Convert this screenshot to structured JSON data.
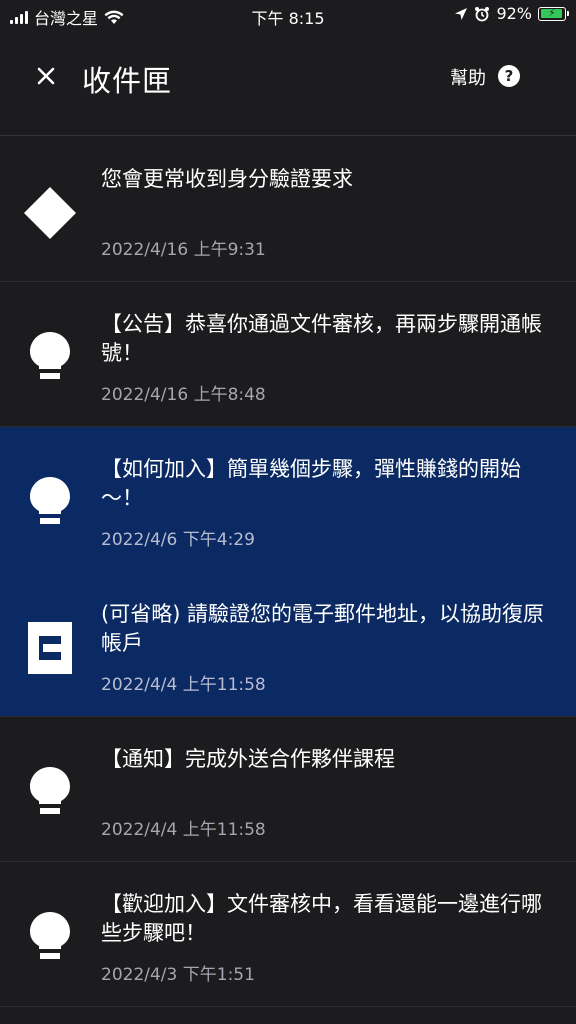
{
  "status_bar": {
    "carrier": "台灣之星",
    "time": "下午 8:15",
    "battery_percent": "92%",
    "battery_level": 0.92,
    "battery_color": "#34c759"
  },
  "header": {
    "close_icon": "close-icon",
    "title": "收件匣",
    "help_label": "幫助",
    "help_icon": "help-circle-icon"
  },
  "colors": {
    "background": "#1c1c1e",
    "unread_background": "#0b2a63",
    "timestamp": "#a4a7b0"
  },
  "messages": [
    {
      "icon": "diamond-icon",
      "title": "您會更常收到身分驗證要求",
      "time": "2022/4/16 上午9:31",
      "unread": false
    },
    {
      "icon": "lightbulb-icon",
      "title": "【公告】恭喜你通過文件審核，再兩步驟開通帳號！",
      "time": "2022/4/16 上午8:48",
      "unread": false
    },
    {
      "icon": "lightbulb-icon",
      "title": "【如何加入】簡單幾個步驟，彈性賺錢的開始～！",
      "time": "2022/4/6 下午4:29",
      "unread": true
    },
    {
      "icon": "document-icon",
      "title": "(可省略) 請驗證您的電子郵件地址，以協助復原帳戶",
      "time": "2022/4/4 上午11:58",
      "unread": true
    },
    {
      "icon": "lightbulb-icon",
      "title": "【通知】完成外送合作夥伴課程",
      "time": "2022/4/4 上午11:58",
      "unread": false
    },
    {
      "icon": "lightbulb-icon",
      "title": "【歡迎加入】文件審核中，看看還能一邊進行哪些步驟吧！",
      "time": "2022/4/3 下午1:51",
      "unread": false
    }
  ]
}
